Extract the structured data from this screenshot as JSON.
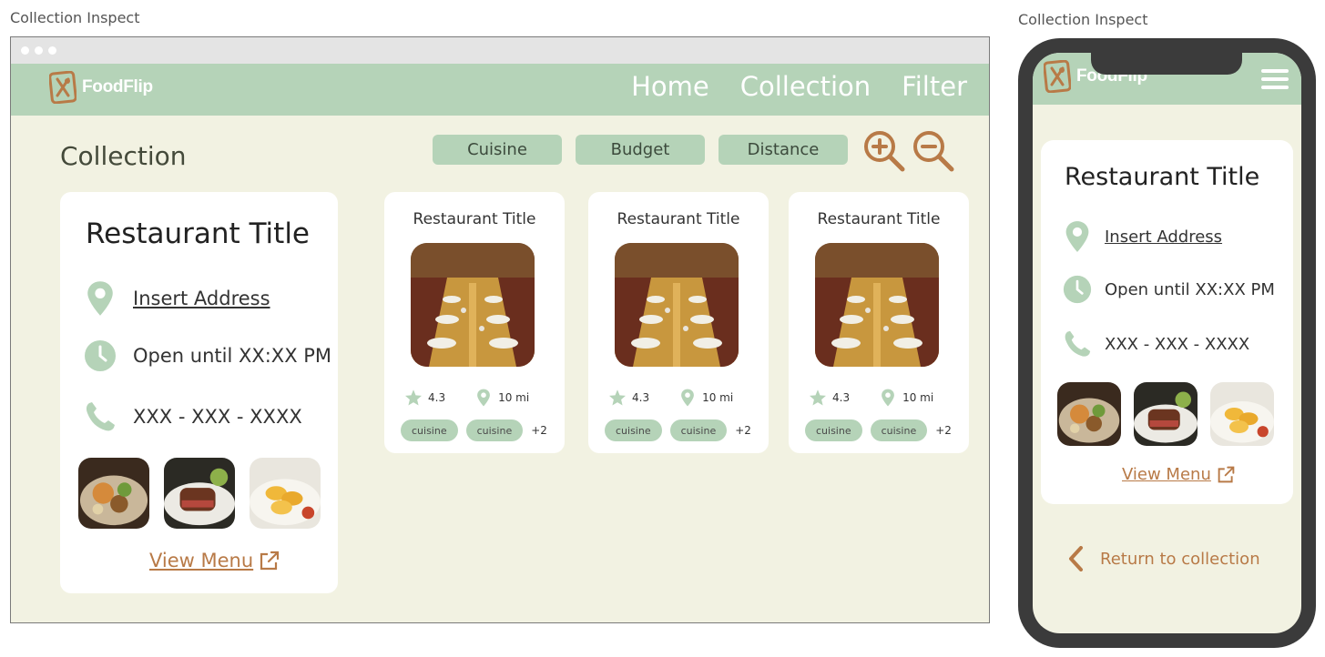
{
  "labels": {
    "desktop": "Collection Inspect",
    "mobile": "Collection Inspect"
  },
  "brand": {
    "name": "FoodFlip"
  },
  "nav": {
    "items": [
      "Home",
      "Collection",
      "Filter"
    ]
  },
  "page": {
    "title": "Collection"
  },
  "filters": [
    "Cuisine",
    "Budget",
    "Distance"
  ],
  "detail": {
    "title": "Restaurant Title",
    "address": "Insert Address",
    "hours": "Open until XX:XX PM",
    "phone": "XXX - XXX - XXXX",
    "view_menu": "View Menu"
  },
  "restaurants": [
    {
      "title": "Restaurant Title",
      "rating": "4.3",
      "distance": "10 mi",
      "tags": [
        "cuisine",
        "cuisine"
      ],
      "more": "+2"
    },
    {
      "title": "Restaurant Title",
      "rating": "4.3",
      "distance": "10 mi",
      "tags": [
        "cuisine",
        "cuisine"
      ],
      "more": "+2"
    },
    {
      "title": "Restaurant Title",
      "rating": "4.3",
      "distance": "10 mi",
      "tags": [
        "cuisine",
        "cuisine"
      ],
      "more": "+2"
    }
  ],
  "mobile": {
    "return_label": "Return to collection"
  },
  "colors": {
    "accent_green": "#b5d3b8",
    "background": "#f2f2e2",
    "link_brown": "#b87a47",
    "phone_body": "#3b3b3b"
  },
  "icons": [
    "logo-icon",
    "map-pin-icon",
    "clock-icon",
    "phone-icon",
    "zoom-in-icon",
    "zoom-out-icon",
    "star-icon",
    "external-link-icon",
    "hamburger-icon",
    "chevron-left-icon"
  ]
}
